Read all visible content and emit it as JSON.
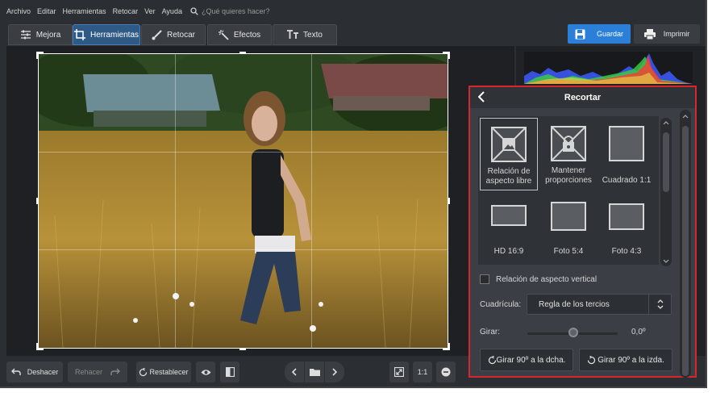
{
  "menu": {
    "items": [
      "Archivo",
      "Editar",
      "Herramientas",
      "Retocar",
      "Ver",
      "Ayuda"
    ],
    "search_placeholder": "¿Qué quieres hacer?"
  },
  "tabs": [
    {
      "label": "Mejora",
      "icon": "sliders-icon"
    },
    {
      "label": "Herramientas",
      "icon": "crop-icon",
      "active": true
    },
    {
      "label": "Retocar",
      "icon": "brush-icon"
    },
    {
      "label": "Efectos",
      "icon": "magic-wand-icon"
    },
    {
      "label": "Texto",
      "icon": "text-icon"
    }
  ],
  "actions": {
    "save": "Guardar",
    "print": "Imprimir"
  },
  "bottom": {
    "undo": "Deshacer",
    "redo": "Rehacer",
    "reset": "Restablecer",
    "zoom_1to1": "1:1"
  },
  "panel": {
    "title": "Recortar",
    "presets": [
      {
        "label_line1": "Relación de",
        "label_line2": "aspecto libre",
        "icon": "image-free-ratio-icon",
        "selected": true
      },
      {
        "label_line1": "Mantener",
        "label_line2": "proporciones",
        "icon": "lock-ratio-icon"
      },
      {
        "label_line1": "Cuadrado 1:1",
        "label_line2": "",
        "icon": "square-icon"
      },
      {
        "label_line1": "HD 16:9",
        "label_line2": "",
        "icon": "wide-rect-icon"
      },
      {
        "label_line1": "Foto 5:4",
        "label_line2": "",
        "icon": "rect-5-4-icon"
      },
      {
        "label_line1": "Foto 4:3",
        "label_line2": "",
        "icon": "rect-4-3-icon"
      }
    ],
    "vertical_ratio_label": "Relación de aspecto vertical",
    "grid_label": "Cuadrícula:",
    "grid_value": "Regla de los tercios",
    "rotate_label": "Girar:",
    "rotate_value": "0,0º",
    "rotate_fraction": 0.5,
    "rotate_right": "Girar 90º a la dcha.",
    "rotate_left": "Girar 90º a la izda."
  },
  "colors": {
    "accent_blue": "#2b7fd8",
    "highlight_red": "#d8262d",
    "tab_active": "#2f5a86"
  }
}
